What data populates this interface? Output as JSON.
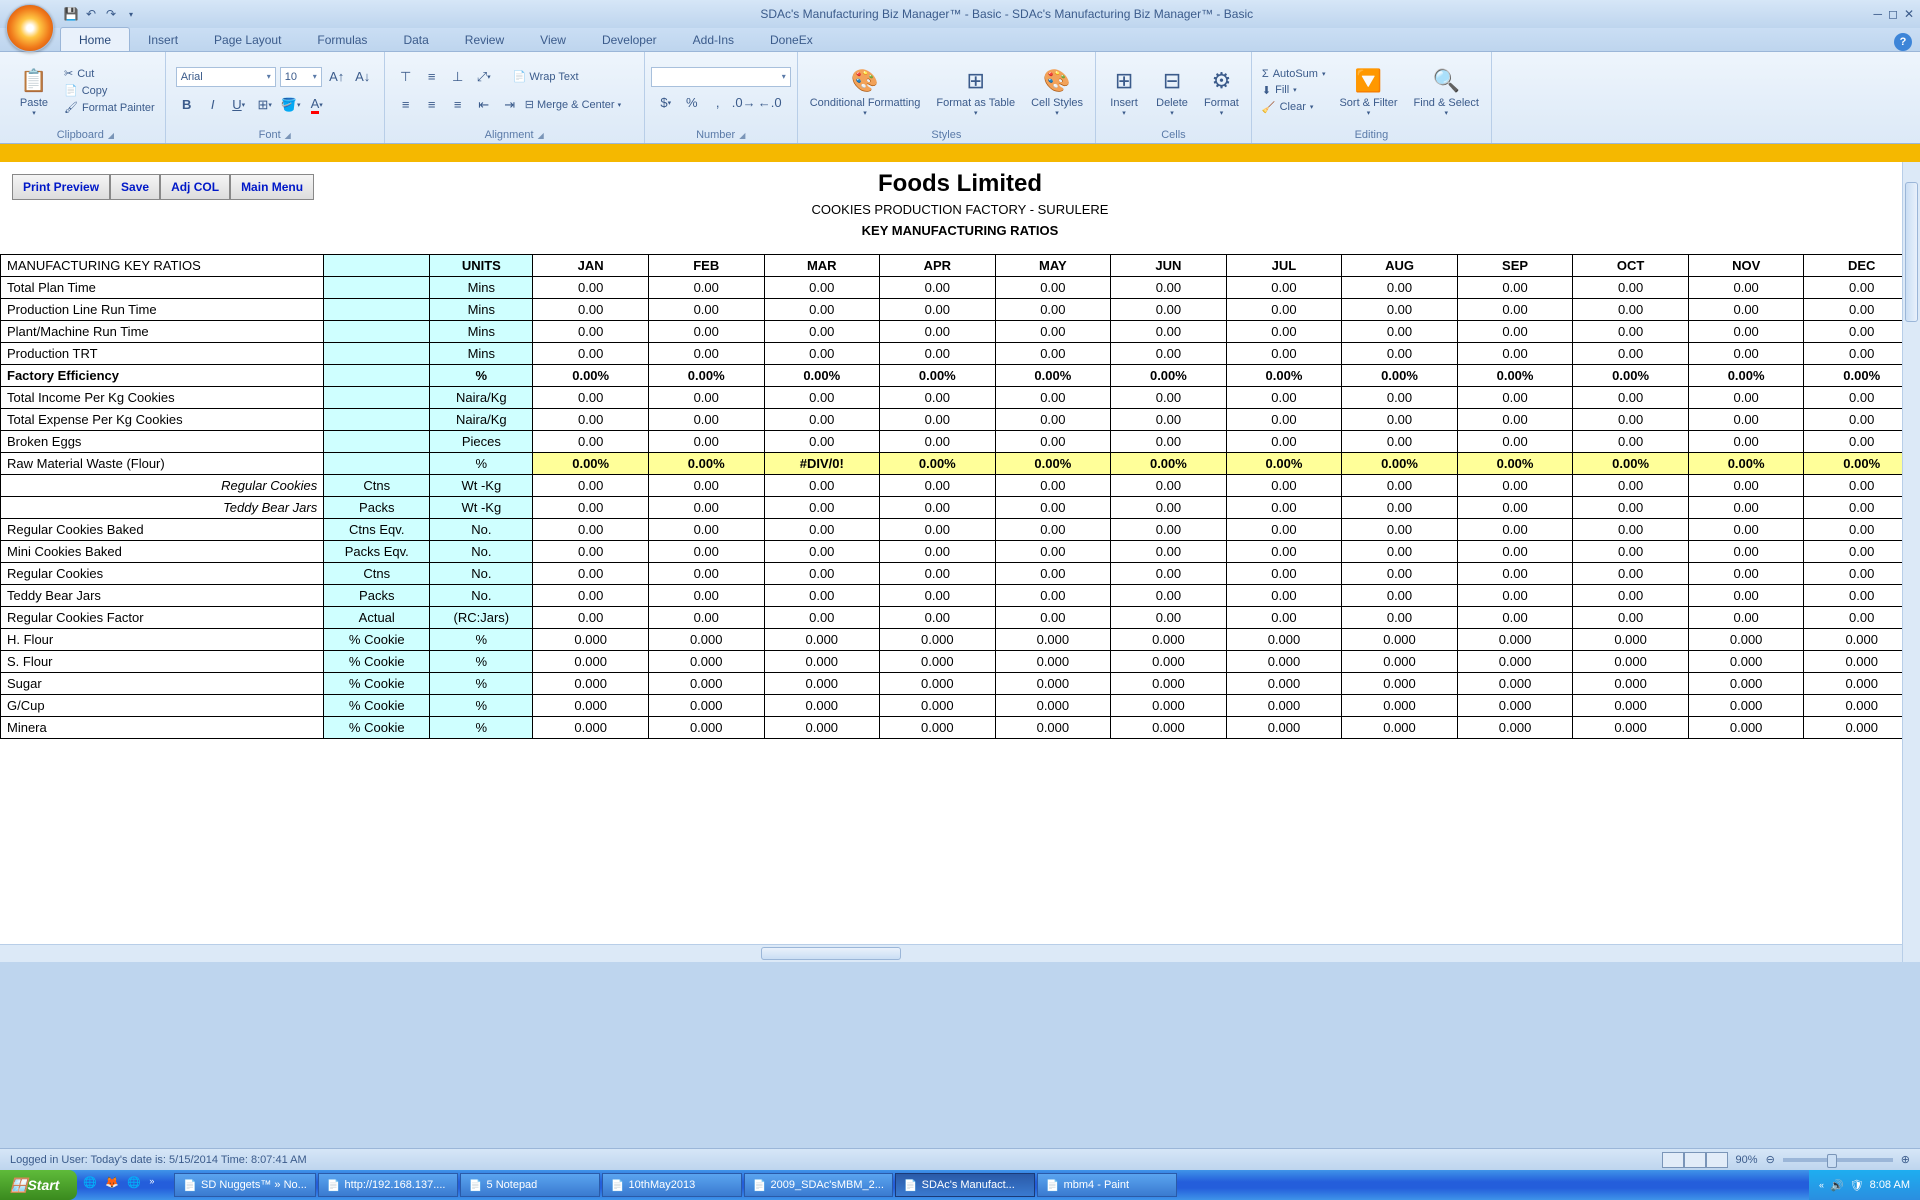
{
  "app": {
    "title": "SDAc's Manufacturing Biz Manager™ - Basic - SDAc's Manufacturing Biz Manager™ - Basic",
    "tabs": [
      "Home",
      "Insert",
      "Page Layout",
      "Formulas",
      "Data",
      "Review",
      "View",
      "Developer",
      "Add-Ins",
      "DoneEx"
    ],
    "activeTab": "Home"
  },
  "ribbon": {
    "clipboard": {
      "paste": "Paste",
      "cut": "Cut",
      "copy": "Copy",
      "fmt": "Format Painter",
      "label": "Clipboard"
    },
    "font": {
      "name": "Arial",
      "size": "10",
      "label": "Font"
    },
    "alignment": {
      "wrap": "Wrap Text",
      "merge": "Merge & Center",
      "label": "Alignment"
    },
    "number": {
      "label": "Number"
    },
    "styles": {
      "cond": "Conditional Formatting",
      "fat": "Format as Table",
      "cell": "Cell Styles",
      "label": "Styles"
    },
    "cells": {
      "insert": "Insert",
      "delete": "Delete",
      "format": "Format",
      "label": "Cells"
    },
    "editing": {
      "sum": "AutoSum",
      "fill": "Fill",
      "clear": "Clear",
      "sort": "Sort & Filter",
      "find": "Find & Select",
      "label": "Editing"
    }
  },
  "sheetButtons": [
    "Print Preview",
    "Save",
    "Adj COL",
    "Main Menu"
  ],
  "header": {
    "company": "Foods Limited",
    "sub": "COOKIES PRODUCTION FACTORY - SURULERE",
    "key": "KEY MANUFACTURING RATIOS"
  },
  "table": {
    "corner": "MANUFACTURING KEY RATIOS",
    "unitsHdr": "UNITS",
    "months": [
      "JAN",
      "FEB",
      "MAR",
      "APR",
      "MAY",
      "JUN",
      "JUL",
      "AUG",
      "SEP",
      "OCT",
      "NOV",
      "DEC"
    ],
    "rows": [
      {
        "label": "Total Plan Time",
        "c2": "",
        "units": "Mins",
        "vals": [
          "0.00",
          "0.00",
          "0.00",
          "0.00",
          "0.00",
          "0.00",
          "0.00",
          "0.00",
          "0.00",
          "0.00",
          "0.00",
          "0.00"
        ]
      },
      {
        "label": "Production Line Run Time",
        "c2": "",
        "units": "Mins",
        "vals": [
          "0.00",
          "0.00",
          "0.00",
          "0.00",
          "0.00",
          "0.00",
          "0.00",
          "0.00",
          "0.00",
          "0.00",
          "0.00",
          "0.00"
        ]
      },
      {
        "label": "Plant/Machine Run Time",
        "c2": "",
        "units": "Mins",
        "vals": [
          "0.00",
          "0.00",
          "0.00",
          "0.00",
          "0.00",
          "0.00",
          "0.00",
          "0.00",
          "0.00",
          "0.00",
          "0.00",
          "0.00"
        ]
      },
      {
        "label": "Production TRT",
        "c2": "",
        "units": "Mins",
        "vals": [
          "0.00",
          "0.00",
          "0.00",
          "0.00",
          "0.00",
          "0.00",
          "0.00",
          "0.00",
          "0.00",
          "0.00",
          "0.00",
          "0.00"
        ]
      },
      {
        "label": "Factory Efficiency",
        "c2": "",
        "units": "%",
        "style": "bold",
        "vals": [
          "0.00%",
          "0.00%",
          "0.00%",
          "0.00%",
          "0.00%",
          "0.00%",
          "0.00%",
          "0.00%",
          "0.00%",
          "0.00%",
          "0.00%",
          "0.00%"
        ]
      },
      {
        "label": "Total Income Per Kg Cookies",
        "c2": "",
        "units": "Naira/Kg",
        "vals": [
          "0.00",
          "0.00",
          "0.00",
          "0.00",
          "0.00",
          "0.00",
          "0.00",
          "0.00",
          "0.00",
          "0.00",
          "0.00",
          "0.00"
        ]
      },
      {
        "label": "Total Expense Per Kg Cookies",
        "c2": "",
        "units": "Naira/Kg",
        "vals": [
          "0.00",
          "0.00",
          "0.00",
          "0.00",
          "0.00",
          "0.00",
          "0.00",
          "0.00",
          "0.00",
          "0.00",
          "0.00",
          "0.00"
        ]
      },
      {
        "label": "Broken Eggs",
        "c2": "",
        "units": "Pieces",
        "vals": [
          "0.00",
          "0.00",
          "0.00",
          "0.00",
          "0.00",
          "0.00",
          "0.00",
          "0.00",
          "0.00",
          "0.00",
          "0.00",
          "0.00"
        ]
      },
      {
        "label": "Raw Material Waste (Flour)",
        "c2": "",
        "units": "%",
        "style": "yl",
        "vals": [
          "0.00%",
          "0.00%",
          "#DIV/0!",
          "0.00%",
          "0.00%",
          "0.00%",
          "0.00%",
          "0.00%",
          "0.00%",
          "0.00%",
          "0.00%",
          "0.00%"
        ]
      },
      {
        "label": "Regular Cookies",
        "c2": "Ctns",
        "units": "Wt -Kg",
        "style": "ital",
        "vals": [
          "0.00",
          "0.00",
          "0.00",
          "0.00",
          "0.00",
          "0.00",
          "0.00",
          "0.00",
          "0.00",
          "0.00",
          "0.00",
          "0.00"
        ]
      },
      {
        "label": "Teddy Bear Jars",
        "c2": "Packs",
        "units": "Wt -Kg",
        "style": "ital",
        "vals": [
          "0.00",
          "0.00",
          "0.00",
          "0.00",
          "0.00",
          "0.00",
          "0.00",
          "0.00",
          "0.00",
          "0.00",
          "0.00",
          "0.00"
        ]
      },
      {
        "label": "Regular Cookies Baked",
        "c2": "Ctns Eqv.",
        "units": "No.",
        "vals": [
          "0.00",
          "0.00",
          "0.00",
          "0.00",
          "0.00",
          "0.00",
          "0.00",
          "0.00",
          "0.00",
          "0.00",
          "0.00",
          "0.00"
        ]
      },
      {
        "label": "Mini Cookies Baked",
        "c2": "Packs Eqv.",
        "units": "No.",
        "vals": [
          "0.00",
          "0.00",
          "0.00",
          "0.00",
          "0.00",
          "0.00",
          "0.00",
          "0.00",
          "0.00",
          "0.00",
          "0.00",
          "0.00"
        ]
      },
      {
        "label": "Regular Cookies",
        "c2": "Ctns",
        "units": "No.",
        "vals": [
          "0.00",
          "0.00",
          "0.00",
          "0.00",
          "0.00",
          "0.00",
          "0.00",
          "0.00",
          "0.00",
          "0.00",
          "0.00",
          "0.00"
        ]
      },
      {
        "label": "Teddy Bear Jars",
        "c2": "Packs",
        "units": "No.",
        "vals": [
          "0.00",
          "0.00",
          "0.00",
          "0.00",
          "0.00",
          "0.00",
          "0.00",
          "0.00",
          "0.00",
          "0.00",
          "0.00",
          "0.00"
        ]
      },
      {
        "label": "Regular Cookies Factor",
        "c2": "Actual",
        "units": "(RC:Jars)",
        "vals": [
          "0.00",
          "0.00",
          "0.00",
          "0.00",
          "0.00",
          "0.00",
          "0.00",
          "0.00",
          "0.00",
          "0.00",
          "0.00",
          "0.00"
        ]
      },
      {
        "label": "H. Flour",
        "c2": "% Cookie",
        "units": "%",
        "vals": [
          "0.000",
          "0.000",
          "0.000",
          "0.000",
          "0.000",
          "0.000",
          "0.000",
          "0.000",
          "0.000",
          "0.000",
          "0.000",
          "0.000"
        ]
      },
      {
        "label": "S. Flour",
        "c2": "% Cookie",
        "units": "%",
        "vals": [
          "0.000",
          "0.000",
          "0.000",
          "0.000",
          "0.000",
          "0.000",
          "0.000",
          "0.000",
          "0.000",
          "0.000",
          "0.000",
          "0.000"
        ]
      },
      {
        "label": "Sugar",
        "c2": "% Cookie",
        "units": "%",
        "vals": [
          "0.000",
          "0.000",
          "0.000",
          "0.000",
          "0.000",
          "0.000",
          "0.000",
          "0.000",
          "0.000",
          "0.000",
          "0.000",
          "0.000"
        ]
      },
      {
        "label": "G/Cup",
        "c2": "% Cookie",
        "units": "%",
        "vals": [
          "0.000",
          "0.000",
          "0.000",
          "0.000",
          "0.000",
          "0.000",
          "0.000",
          "0.000",
          "0.000",
          "0.000",
          "0.000",
          "0.000"
        ]
      },
      {
        "label": "Minera",
        "c2": "% Cookie",
        "units": "%",
        "vals": [
          "0.000",
          "0.000",
          "0.000",
          "0.000",
          "0.000",
          "0.000",
          "0.000",
          "0.000",
          "0.000",
          "0.000",
          "0.000",
          "0.000"
        ]
      }
    ]
  },
  "status": {
    "text": "Logged in User:  Today's date is: 5/15/2014 Time: 8:07:41 AM",
    "zoom": "90%"
  },
  "taskbar": {
    "start": "Start",
    "tasks": [
      "SD Nuggets™ » No...",
      "http://192.168.137....",
      "5 Notepad",
      "10thMay2013",
      "2009_SDAc'sMBM_2...",
      "SDAc's Manufact...",
      "mbm4 - Paint"
    ],
    "activeTask": 5,
    "time": "8:08 AM"
  }
}
